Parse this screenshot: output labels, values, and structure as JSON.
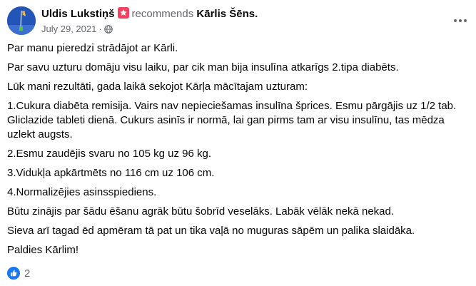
{
  "post": {
    "author": "Uldis Lukstiņš",
    "verb": "recommends",
    "target": "Kārlis Šēns.",
    "date": "July 29, 2021",
    "dot": "·",
    "paragraphs": [
      "Par manu pieredzi strādājot ar Kārli.",
      "Par savu uzturu domāju visu laiku, par cik man bija insulīna atkarīgs 2.tipa diabēts.",
      "Lūk mani rezultāti, gada laikā sekojot Kārļa mācītajam uzturam:",
      "1.Cukura diabēta remisija. Vairs nav nepieciešamas insulīna šprices. Esmu pārgājis uz 1/2 tab. Gliclazide tableti dienā. Cukurs asinīs ir normā, lai gan pirms tam ar visu insulīnu, tas mēdza uzlekt augsts.",
      "2.Esmu zaudējis svaru no 105 kg uz 96 kg.",
      "3.Vidukļa apkārtmēts no 116 cm uz 106 cm.",
      "4.Normalizējies asinsspiediens.",
      "Būtu zinājis par šādu ēšanu agrāk būtu šobrīd veselāks. Labāk vēlāk nekā nekad.",
      "Sieva arī tagad ēd apmēram tā pat un tika vaļā no muguras sāpēm un palika slaidāka.",
      "Paldies Kārlim!"
    ],
    "reaction_count": "2"
  },
  "icons": {
    "badge": "recommend-badge-icon",
    "privacy": "globe-icon",
    "more": "more-options-icon",
    "like": "like-icon"
  },
  "colors": {
    "badge": "#f3425f",
    "like": "#1877f2",
    "secondary_text": "#65676b"
  }
}
